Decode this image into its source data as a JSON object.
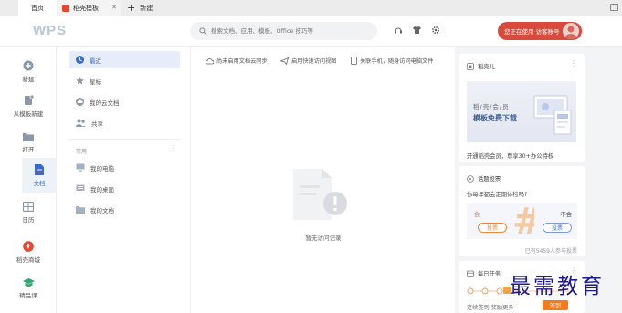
{
  "tabs": [
    {
      "label": "首页"
    },
    {
      "label": "稻壳模板",
      "close": "✕"
    },
    {
      "label": "新建",
      "plus": "+"
    }
  ],
  "header": {
    "logo": "WPS",
    "search_placeholder": "搜索文档、应用、模板、Office 技巧等",
    "login_label": "您正在使用 访客账号"
  },
  "leftnav": [
    {
      "label": "新建",
      "icon": "plus-circle-icon"
    },
    {
      "label": "从模板新建",
      "icon": "template-icon"
    },
    {
      "label": "打开",
      "icon": "folder-icon"
    },
    {
      "label": "文档",
      "icon": "document-icon"
    },
    {
      "label": "日历",
      "icon": "calendar-icon"
    },
    {
      "label": "稻壳商城",
      "icon": "shop-icon"
    },
    {
      "label": "精品课",
      "icon": "course-icon"
    }
  ],
  "sidebar": {
    "items": [
      {
        "label": "最近",
        "icon": "clock-icon"
      },
      {
        "label": "星标",
        "icon": "star-icon"
      },
      {
        "label": "我的云文档",
        "icon": "cloud-icon"
      },
      {
        "label": "共享",
        "icon": "share-icon"
      }
    ],
    "section_label": "常用",
    "common": [
      {
        "label": "我的电脑",
        "icon": "computer-icon"
      },
      {
        "label": "我的桌面",
        "icon": "desktop-icon"
      },
      {
        "label": "我的文档",
        "icon": "folder-icon"
      }
    ]
  },
  "main": {
    "toolbar": [
      {
        "label": "尚未启用文档云同步",
        "icon": "cloud-sync-icon"
      },
      {
        "label": "启用快速访问视图",
        "icon": "send-icon"
      },
      {
        "label": "关联手机，随身访问电脑文件",
        "icon": "phone-icon"
      }
    ],
    "empty_text": "暂无访问记录"
  },
  "right": {
    "promo": {
      "title": "稻壳儿",
      "banner_sub": "稻/壳/会/员",
      "banner_main": "模板免费下载",
      "desc": "开通稻壳会员，尊享30+办公特权"
    },
    "vote": {
      "title": "话题投票",
      "question": "你每年都会定期体检吗?",
      "option_yes": "会",
      "option_no": "不会",
      "vote_label": "投票",
      "count_text": "已有5459人参与投票"
    },
    "tasks": {
      "title": "每日任务",
      "desc": "连续签到 奖励更多",
      "button": "签到"
    }
  },
  "watermark": "最需教育",
  "colors": {
    "accent_blue": "#3b6bc8",
    "login_red": "#d74a3c",
    "task_orange": "#f37a1f"
  }
}
